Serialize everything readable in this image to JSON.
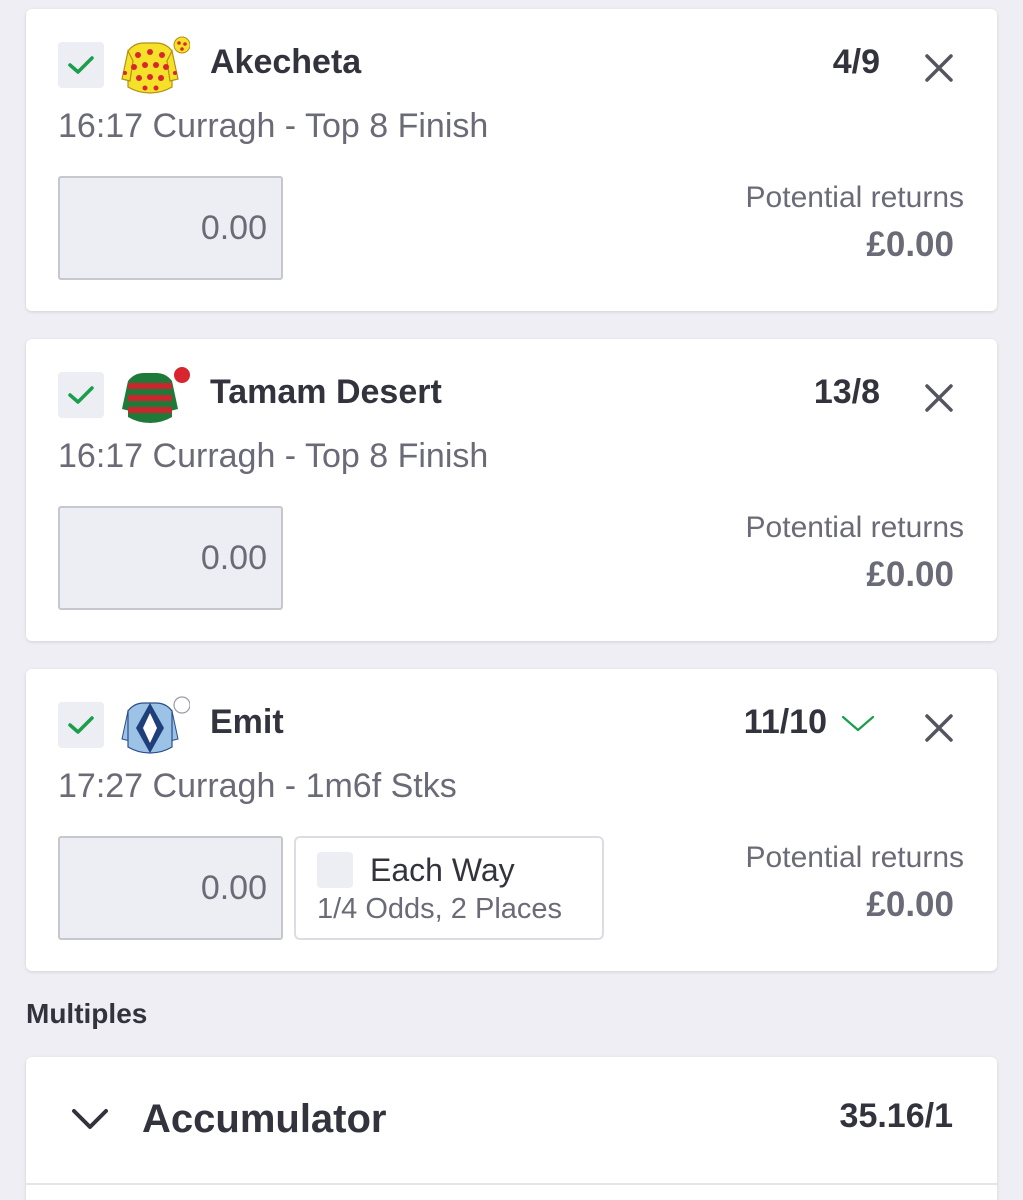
{
  "colors": {
    "check": "#1a9e4b",
    "text_dark": "#33333d",
    "text_muted": "#6b6b78",
    "background": "#eeeef4"
  },
  "selections": [
    {
      "horse": "Akecheta",
      "odds": "4/9",
      "event": "16:17 Curragh - Top 8 Finish",
      "stake_placeholder": "0.00",
      "potential_returns_label": "Potential returns",
      "potential_returns": "£0.00",
      "silks": "yellow-red-spots-silks-icon"
    },
    {
      "horse": "Tamam Desert",
      "odds": "13/8",
      "event": "16:17 Curragh - Top 8 Finish",
      "stake_placeholder": "0.00",
      "potential_returns_label": "Potential returns",
      "potential_returns": "£0.00",
      "silks": "green-red-hoops-silks-icon"
    },
    {
      "horse": "Emit",
      "odds": "11/10",
      "event": "17:27 Curragh - 1m6f Stks",
      "stake_placeholder": "0.00",
      "each_way_label": "Each Way",
      "each_way_terms": "1/4 Odds, 2 Places",
      "potential_returns_label": "Potential returns",
      "potential_returns": "£0.00",
      "silks": "blue-diamonds-silks-icon"
    }
  ],
  "multiples": {
    "section_title": "Multiples",
    "items": [
      {
        "name": "Accumulator",
        "odds": "35.16/1"
      }
    ]
  }
}
